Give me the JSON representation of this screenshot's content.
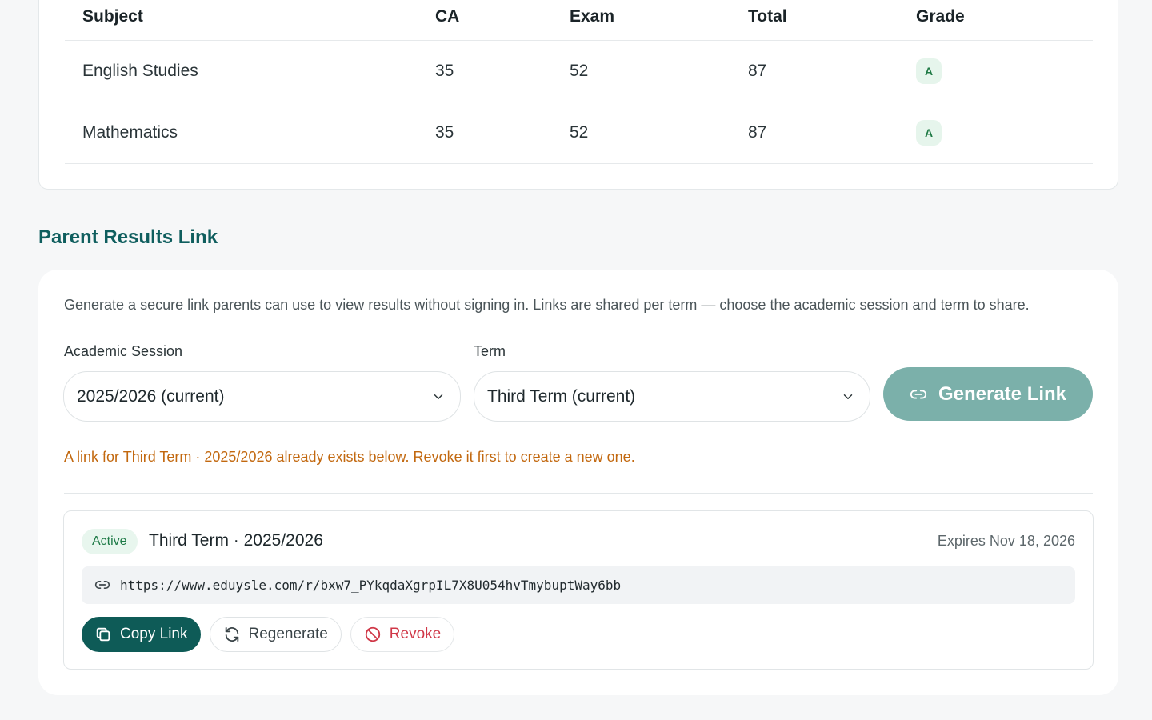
{
  "results_table": {
    "headers": [
      "Subject",
      "CA",
      "Exam",
      "Total",
      "Grade"
    ],
    "rows": [
      {
        "subject": "English Studies",
        "ca": "35",
        "exam": "52",
        "total": "87",
        "grade": "A"
      },
      {
        "subject": "Mathematics",
        "ca": "35",
        "exam": "52",
        "total": "87",
        "grade": "A"
      }
    ]
  },
  "parent_link": {
    "title": "Parent Results Link",
    "description": "Generate a secure link parents can use to view results without signing in. Links are shared per term — choose the academic session and term to share.",
    "session_label": "Academic Session",
    "session_value": "2025/2026 (current)",
    "term_label": "Term",
    "term_value": "Third Term (current)",
    "generate_label": "Generate Link",
    "warning": "A link for Third Term · 2025/2026 already exists below. Revoke it first to create a new one.",
    "existing_link": {
      "status": "Active",
      "term": "Third Term · 2025/2026",
      "expires": "Expires Nov 18, 2026",
      "url": "https://www.eduysle.com/r/bxw7_PYkqdaXgrpIL7X8U054hvTmybuptWay6bb",
      "copy_label": "Copy Link",
      "regenerate_label": "Regenerate",
      "revoke_label": "Revoke"
    }
  },
  "colors": {
    "brand": "#0e5b57",
    "heading": "#0f5e5e",
    "generate_disabled": "#7bb0aa",
    "warning": "#c2680f",
    "danger": "#d03848",
    "success_bg": "#e6f5ec",
    "success_text": "#1f7a45"
  },
  "icons": {
    "chevron": "chevron-down-icon",
    "link": "link-icon",
    "copy": "copy-icon",
    "regenerate": "refresh-icon",
    "revoke": "ban-icon"
  }
}
